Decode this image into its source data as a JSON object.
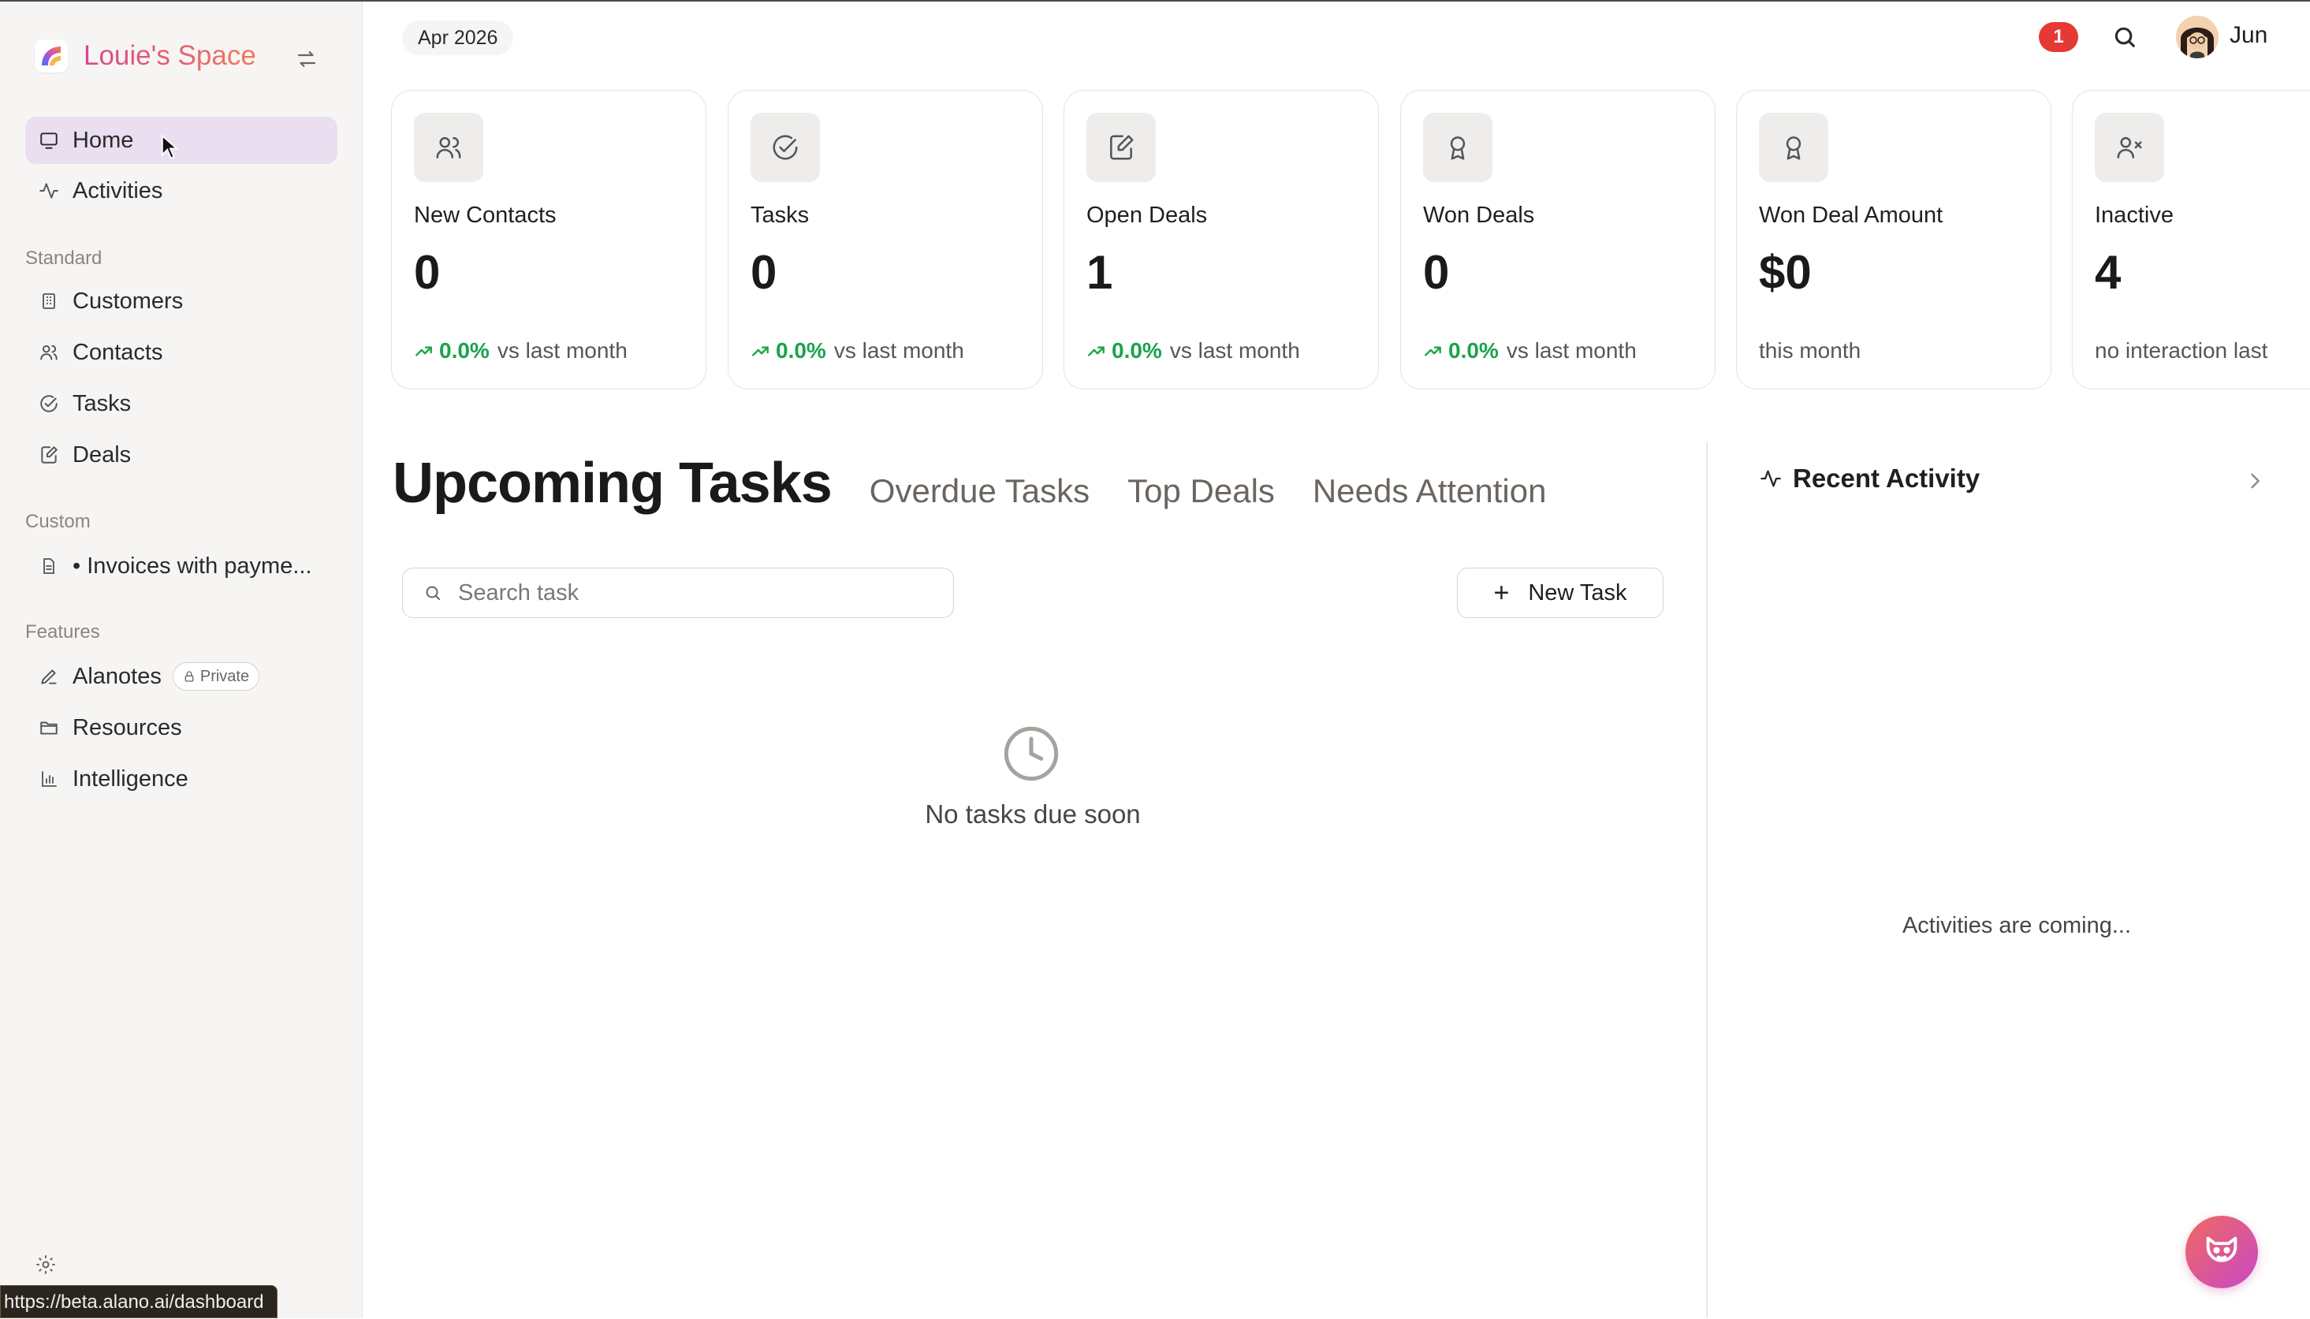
{
  "workspace": {
    "name": "Louie's Space"
  },
  "sidebar": {
    "main_items": [
      {
        "label": "Home",
        "icon": "monitor-icon",
        "active": true
      },
      {
        "label": "Activities",
        "icon": "activity-icon"
      }
    ],
    "standard_label": "Standard",
    "standard_items": [
      {
        "label": "Customers",
        "icon": "building-icon"
      },
      {
        "label": "Contacts",
        "icon": "users-icon"
      },
      {
        "label": "Tasks",
        "icon": "check-circle-icon"
      },
      {
        "label": "Deals",
        "icon": "edit-file-icon"
      }
    ],
    "custom_label": "Custom",
    "custom_items": [
      {
        "label": "• Invoices with payme...",
        "icon": "file-text-icon"
      }
    ],
    "features_label": "Features",
    "features_items": [
      {
        "label": "Alanotes",
        "icon": "pen-icon",
        "badge": "Private"
      },
      {
        "label": "Resources",
        "icon": "folder-icon"
      },
      {
        "label": "Intelligence",
        "icon": "bar-chart-icon"
      }
    ]
  },
  "header": {
    "date": "Apr 2026",
    "notification_count": "1",
    "user_name": "Jun"
  },
  "stats": [
    {
      "title": "New Contacts",
      "value": "0",
      "pct": "0.0%",
      "suffix": "vs last month",
      "icon": "users-icon"
    },
    {
      "title": "Tasks",
      "value": "0",
      "pct": "0.0%",
      "suffix": "vs last month",
      "icon": "check-circle-icon"
    },
    {
      "title": "Open Deals",
      "value": "1",
      "pct": "0.0%",
      "suffix": "vs last month",
      "icon": "edit-file-icon"
    },
    {
      "title": "Won Deals",
      "value": "0",
      "pct": "0.0%",
      "suffix": "vs last month",
      "icon": "award-icon"
    },
    {
      "title": "Won Deal Amount",
      "value": "$0",
      "suffix": "this month",
      "icon": "award-icon"
    },
    {
      "title": "Inactive",
      "value": "4",
      "suffix": "no interaction last",
      "icon": "user-x-icon"
    }
  ],
  "tasks": {
    "active_tab": "Upcoming Tasks",
    "tabs": [
      "Overdue Tasks",
      "Top Deals",
      "Needs Attention"
    ],
    "search_placeholder": "Search task",
    "new_task_label": "New Task",
    "empty_text": "No tasks due soon"
  },
  "recent_activity": {
    "title": "Recent Activity",
    "empty_text": "Activities are coming..."
  },
  "status_bar": {
    "url": "https://beta.alano.ai/dashboard"
  },
  "colors": {
    "accent": "#e35a84",
    "positive": "#1aa34a",
    "notification": "#e53935",
    "active_nav": "#e9dff0"
  }
}
